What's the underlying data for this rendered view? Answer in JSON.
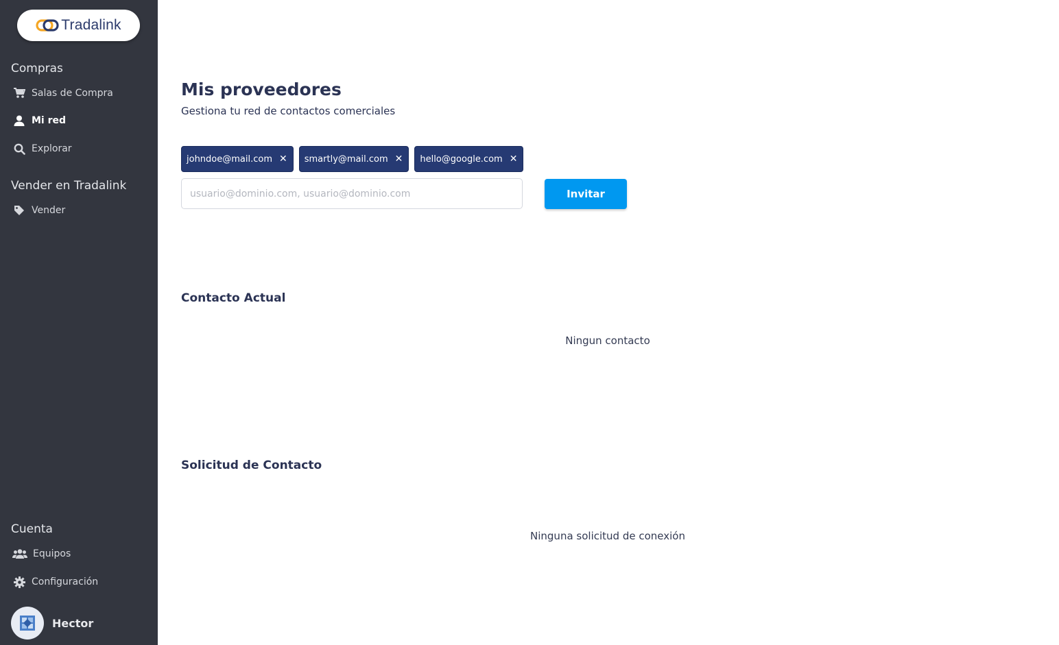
{
  "app": {
    "logo_text": "Tradalink"
  },
  "sidebar": {
    "sections": [
      {
        "title": "Compras"
      },
      {
        "title": "Vender en Tradalink"
      },
      {
        "title": "Cuenta"
      }
    ],
    "items": [
      {
        "label": "Salas de Compra",
        "icon": "cart-icon"
      },
      {
        "label": "Mi red",
        "icon": "user-icon",
        "active": true
      },
      {
        "label": "Explorar",
        "icon": "search-icon"
      },
      {
        "label": "Vender",
        "icon": "tag-icon"
      },
      {
        "label": "Equipos",
        "icon": "users-icon"
      },
      {
        "label": "Configuración",
        "icon": "gear-icon"
      }
    ],
    "user": {
      "name": "Hector"
    }
  },
  "main": {
    "title": "Mis proveedores",
    "subtitle": "Gestiona tu red de contactos comerciales",
    "chips": [
      {
        "email": "johndoe@mail.com"
      },
      {
        "email": "smartly@mail.com"
      },
      {
        "email": "hello@google.com"
      }
    ],
    "invite": {
      "placeholder": "usuario@dominio.com, usuario@dominio.com",
      "value": "",
      "button_label": "Invitar"
    },
    "current_contacts": {
      "title": "Contacto Actual",
      "empty": "Ningun contacto"
    },
    "requests": {
      "title": "Solicitud de Contacto",
      "empty": "Ninguna solicitud de conexión"
    }
  },
  "colors": {
    "sidebar_bg": "#33363f",
    "chip_bg": "#263a73",
    "primary_button": "#0098f0",
    "text_dark": "#2b3354",
    "logo_orange": "#f5a623"
  }
}
